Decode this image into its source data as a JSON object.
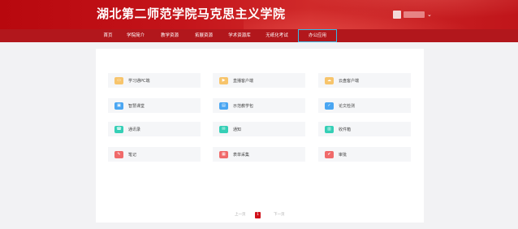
{
  "header": {
    "title": "湖北第二师范学院马克思主义学院"
  },
  "nav": {
    "items": [
      {
        "label": "首页"
      },
      {
        "label": "学院简介"
      },
      {
        "label": "教学资源"
      },
      {
        "label": "拓展资源"
      },
      {
        "label": "学术资源库"
      },
      {
        "label": "无纸化考试"
      },
      {
        "label": "办公应用"
      }
    ]
  },
  "apps": [
    {
      "label": "学习通PC端",
      "icon": "pc-icon",
      "color": "#f7c46b"
    },
    {
      "label": "直播客户端",
      "icon": "live-icon",
      "color": "#f7c46b"
    },
    {
      "label": "云盘客户端",
      "icon": "cloud-icon",
      "color": "#f7c46b"
    },
    {
      "label": "智慧课堂",
      "icon": "classroom-icon",
      "color": "#4aa6f2"
    },
    {
      "label": "示范教学包",
      "icon": "package-icon",
      "color": "#4aa6f2"
    },
    {
      "label": "论文检测",
      "icon": "check-icon",
      "color": "#4aa6f2"
    },
    {
      "label": "通讯录",
      "icon": "contacts-icon",
      "color": "#35cfb6"
    },
    {
      "label": "通知",
      "icon": "notice-icon",
      "color": "#35cfb6"
    },
    {
      "label": "收件箱",
      "icon": "inbox-icon",
      "color": "#35cfb6"
    },
    {
      "label": "笔记",
      "icon": "notes-icon",
      "color": "#f06a6a"
    },
    {
      "label": "表单采集",
      "icon": "form-icon",
      "color": "#f06a6a"
    },
    {
      "label": "审批",
      "icon": "approval-icon",
      "color": "#f06a6a"
    }
  ],
  "pager": {
    "prev": "上一页",
    "current": "1",
    "next": "下一页"
  }
}
